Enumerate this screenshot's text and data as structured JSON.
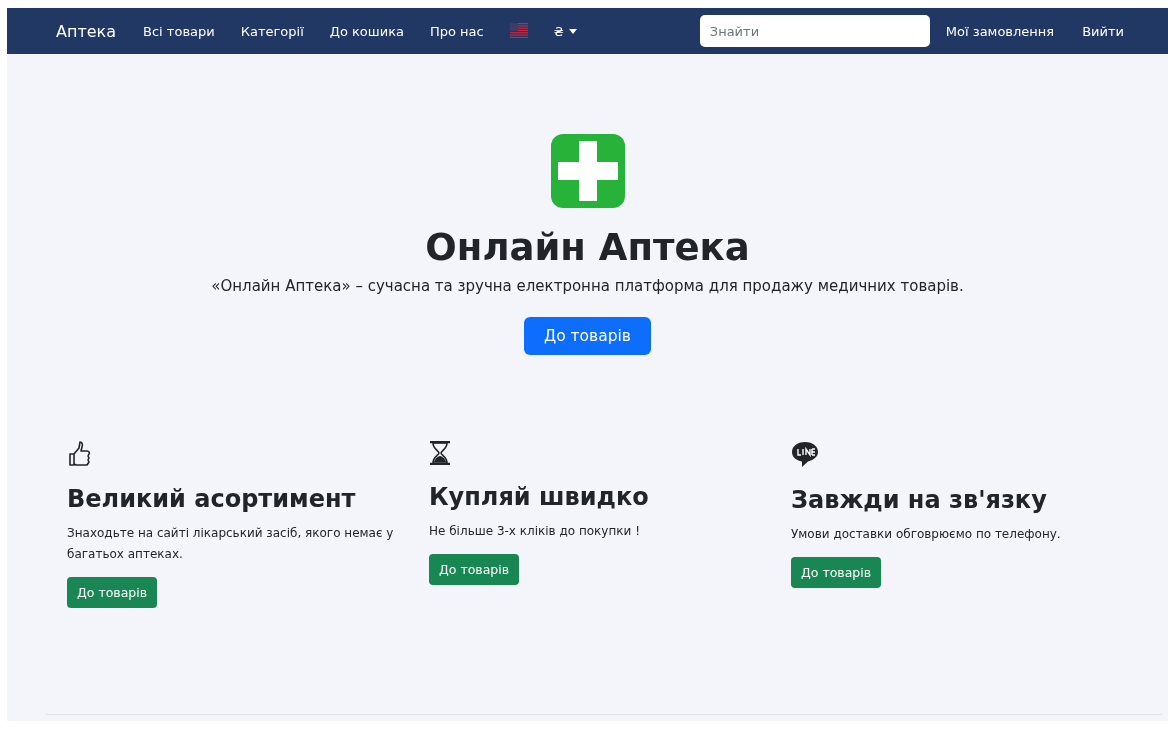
{
  "navbar": {
    "brand": "Аптека",
    "links": [
      "Всі товари",
      "Категорії",
      "До кошика",
      "Про нас"
    ],
    "currency": "₴",
    "search": {
      "placeholder": "Знайти"
    },
    "right_links": [
      "Мої замовлення",
      "Вийти"
    ]
  },
  "hero": {
    "title": "Онлайн Аптека",
    "text": "«Онлайн Аптека» – сучасна та зручна електронна платформа для продажу медичних товарів.",
    "button": "До товарів"
  },
  "features": [
    {
      "title": "Великий асортимент",
      "text": "Знаходьте на сайті лікарський засіб, якого немає у багатьох аптеках.",
      "button": "До товарів"
    },
    {
      "title": "Купляй швидко",
      "text": "Не більше 3-х кліків до покупки !",
      "button": "До товарів"
    },
    {
      "title": "Завжди на зв'язку",
      "text": "Умови доставки обговрюємо по телефону.",
      "button": "До товарів"
    }
  ]
}
